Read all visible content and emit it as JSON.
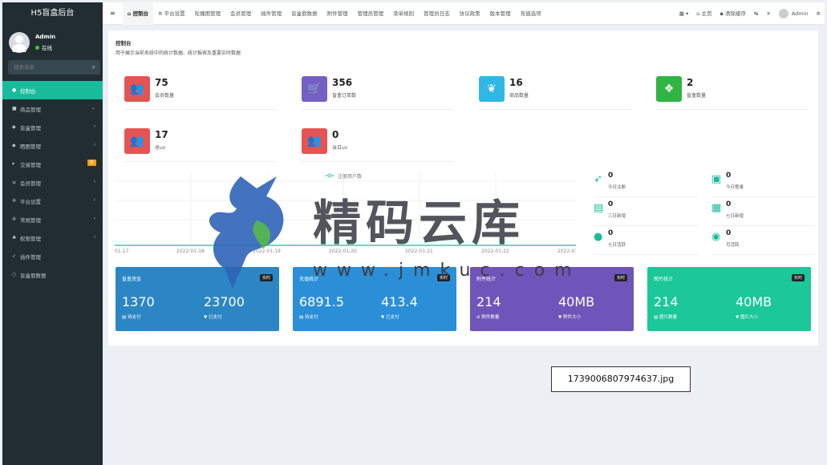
{
  "app_title": "H5盲盒后台",
  "user": {
    "name": "Admin",
    "status": "在线"
  },
  "search": {
    "placeholder": "搜索菜单"
  },
  "sidebar": {
    "items": [
      {
        "label": "控制台",
        "icon": "dashboard-icon",
        "active": true
      },
      {
        "label": "商品管理",
        "icon": "shopping-bag-icon",
        "arrow": "⌄"
      },
      {
        "label": "盲盒管理",
        "icon": "shield-icon",
        "arrow": "‹"
      },
      {
        "label": "晒图管理",
        "icon": "shield-icon",
        "arrow": "‹"
      },
      {
        "label": "交易管理",
        "icon": "cart-icon",
        "badge": "新"
      },
      {
        "label": "会员管理",
        "icon": "list-icon",
        "arrow": "‹"
      },
      {
        "label": "平台设置",
        "icon": "cogs-icon",
        "arrow": "‹"
      },
      {
        "label": "常规管理",
        "icon": "cogs-icon",
        "arrow": "‹"
      },
      {
        "label": "权限管理",
        "icon": "group-icon",
        "arrow": "‹"
      },
      {
        "label": "插件管理",
        "icon": "rocket-icon"
      },
      {
        "label": "盲盒假数据",
        "icon": "circle-icon"
      }
    ]
  },
  "topbar": {
    "tabs": [
      "控制台",
      "平台设置",
      "轮播图管理",
      "会员管理",
      "插件管理",
      "盲盒假数据",
      "附件管理",
      "管理员管理",
      "菜单规则",
      "管理员日志",
      "协议政策",
      "版本管理",
      "充值选项"
    ],
    "right": {
      "home": "主页",
      "clear_cache": "清除缓存",
      "admin": "Admin"
    }
  },
  "content": {
    "title": "控制台",
    "desc": "用于展示当前系统中的统计数据、统计报表及重要实时数据",
    "stats": [
      {
        "value": "75",
        "label": "会员数量",
        "color": "#e65353",
        "icon": "users-icon"
      },
      {
        "value": "356",
        "label": "盲盒订单数",
        "color": "#7460c4",
        "icon": "cart-icon"
      },
      {
        "value": "16",
        "label": "商品数量",
        "color": "#2fb7e5",
        "icon": "leaf-icon"
      },
      {
        "value": "2",
        "label": "盲盒数量",
        "color": "#30b543",
        "icon": "dropbox-icon"
      },
      {
        "value": "17",
        "label": "总uv",
        "color": "#e65353",
        "icon": "users-icon"
      },
      {
        "value": "0",
        "label": "当日uv",
        "color": "#e65353",
        "icon": "users-icon"
      }
    ],
    "chart": {
      "legend": "注册用户数",
      "ticks": [
        "01-17",
        "2022-01-18",
        "2022-01-19",
        "2022-01-20",
        "2022-01-21",
        "2022-01-22",
        "2022-01-23"
      ]
    },
    "mini_stats": [
      {
        "value": "0",
        "label": "今日注册",
        "icon": "rocket-icon"
      },
      {
        "value": "0",
        "label": "今日登录",
        "icon": "id-card-icon"
      },
      {
        "value": "0",
        "label": "三日新增",
        "icon": "database-icon"
      },
      {
        "value": "0",
        "label": "七日新增",
        "icon": "calendar-plus-icon"
      },
      {
        "value": "0",
        "label": "七日活跃",
        "icon": "user-icon"
      },
      {
        "value": "0",
        "label": "月活跃",
        "icon": "user-circle-icon"
      }
    ],
    "cards": [
      {
        "title": "盲盒资金",
        "tag": "实时",
        "v1": "1370",
        "l1": "待支付",
        "v2": "23700",
        "l2": "已支付",
        "color": "#2c86c4"
      },
      {
        "title": "充值统计",
        "tag": "实时",
        "v1": "6891.5",
        "l1": "待支付",
        "v2": "413.4",
        "l2": "已支付",
        "color": "#2b8fd8"
      },
      {
        "title": "附件统计",
        "tag": "实时",
        "v1": "214",
        "l1": "附件数量",
        "v2": "40MB",
        "l2": "附件大小",
        "color": "#6f55b9"
      },
      {
        "title": "图片统计",
        "tag": "实时",
        "v1": "214",
        "l1": "图片数量",
        "v2": "40MB",
        "l2": "图片大小",
        "color": "#1cc79a"
      }
    ]
  },
  "watermark": {
    "text": "精码云库",
    "url": "www.jmkuc.com"
  },
  "filename": "1739006807974637.jpg"
}
